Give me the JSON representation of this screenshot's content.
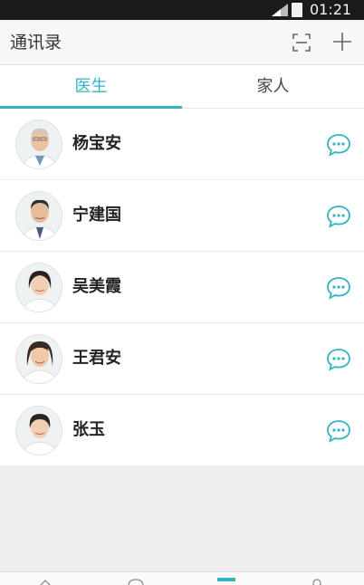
{
  "status_bar": {
    "time": "01:21"
  },
  "header": {
    "title": "通讯录"
  },
  "tabs": [
    {
      "label": "医生",
      "active": true
    },
    {
      "label": "家人",
      "active": false
    }
  ],
  "contacts": [
    {
      "name": "杨宝安"
    },
    {
      "name": "宁建国"
    },
    {
      "name": "吴美霞"
    },
    {
      "name": "王君安"
    },
    {
      "name": "张玉"
    }
  ],
  "colors": {
    "accent": "#33b3c4"
  }
}
